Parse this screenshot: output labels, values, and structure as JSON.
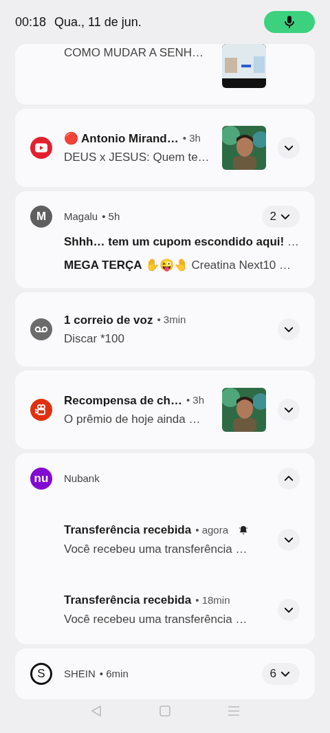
{
  "status_bar": {
    "time": "00:18",
    "date": "Qua., 11 de jun.",
    "mic_active": true
  },
  "notifications": [
    {
      "kind": "partial",
      "text": "COMO MUDAR A SENH…",
      "thumbnail": true
    },
    {
      "kind": "single",
      "title": "🔴 Antonio Mirand…",
      "time": "• 3h",
      "text": "DEUS x JESUS: Quem te…",
      "thumbnail": true,
      "expanded": false
    },
    {
      "kind": "app",
      "icon_text": "M",
      "app": "Magalu",
      "time": "• 5h",
      "count": "2",
      "expanded": false,
      "lines": [
        "**Shhh… tem um cupom escondido aqui!** …",
        "**MEGA TERÇA ✋😜🤚** Creatina Next10 …"
      ]
    },
    {
      "kind": "single",
      "title": "1 correio de voz",
      "time": "• 3min",
      "text": "Discar *100",
      "thumbnail": false,
      "expanded": false
    },
    {
      "kind": "single",
      "title": "Recompensa de ch…",
      "time": "• 3h",
      "text": "O prêmio de hoje ainda …",
      "thumbnail": true,
      "expanded": false
    },
    {
      "kind": "group",
      "icon_text": "nu",
      "app": "Nubank",
      "expanded": true,
      "children": [
        {
          "title": "Transferência recebida",
          "time": "• agora",
          "alerting": true,
          "text": "Você recebeu uma transferência …",
          "expanded": false
        },
        {
          "title": "Transferência recebida",
          "time": "• 18min",
          "alerting": false,
          "text": "Você recebeu uma transferência …",
          "expanded": false
        }
      ]
    },
    {
      "kind": "app",
      "icon_text": "S",
      "app": "SHEIN",
      "time": "• 6min",
      "count": "6",
      "expanded": false
    }
  ]
}
